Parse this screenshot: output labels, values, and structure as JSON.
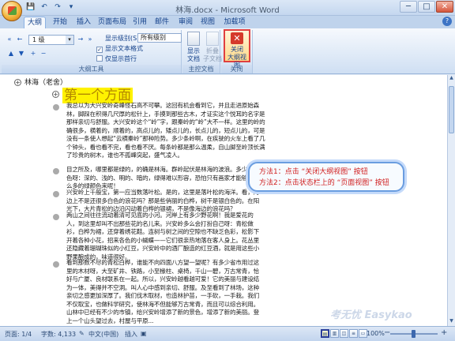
{
  "window": {
    "title": "林海.docx - Microsoft Word",
    "minimize": "─",
    "maximize": "□",
    "close": "✕"
  },
  "qat": {
    "save": "💾",
    "undo": "↶",
    "redo": "↷",
    "more": "▾"
  },
  "tabs": [
    {
      "label": "大纲",
      "active": true
    },
    {
      "label": "开始"
    },
    {
      "label": "插入"
    },
    {
      "label": "页面布局"
    },
    {
      "label": "引用"
    },
    {
      "label": "邮件"
    },
    {
      "label": "审阅"
    },
    {
      "label": "视图"
    },
    {
      "label": "加载项"
    }
  ],
  "help": "?",
  "ribbon": {
    "outline_tools": {
      "label": "大纲工具",
      "level_value": "1 级",
      "show_level_label": "显示级别(S):",
      "show_level_value": "所有级别",
      "show_text_format": "显示文本格式",
      "show_first_line": "仅显示首行",
      "arrows": {
        "promote_top": "«",
        "promote": "←",
        "demote": "→",
        "demote_body": "»",
        "up": "▲",
        "down": "▼",
        "expand": "+",
        "collapse": "−"
      }
    },
    "master_doc": {
      "label": "主控文档",
      "show_doc": "显示\n文档",
      "collapse_subdoc": "折叠\n子文档"
    },
    "close": {
      "label": "关闭",
      "close_outline_line1": "关闭",
      "close_outline_line2": "大纲视图",
      "icon": "✕"
    }
  },
  "document": {
    "top_heading": "林海（老舍）",
    "h1": "第一个方面",
    "paragraphs": [
      "我总以为大兴安岭奇峰怪石高不可攀。这回有机会看到它，并且走进原始森林，脚踩在积得几尺厚的松针上，手摸到那些古木，才证实这个悦耳的名字是那样亲切与舒服。大兴安岭这个“岭”字，跟秦岭的“岭”大不一样。这里的岭的确很多，横着的，顺着的，高点儿的，矮点儿的，长点儿的，短点儿的，可是没有一条使人想起“云横秦岭”那种险势。多少条岭啊，在疾驶的火车上看了几个钟头，看也看不完，看也看不厌。每条岭都是那么温柔，自山脚至岭顶长满了珍贵的树木，谁也不孤峰突起，盛气凌人。",
      "目之所及，哪里都是绿的，的确是林海。群岭起伏是林海的波浪。多少种绿颜色呀：深的、浅的、明的、暗的，绿得难以形容，恐怕只有画家才能够调出这么多的绿颜色来呢！",
      "兴安岭上千般宝，第一应当数落叶松。是的，这里是落叶松的海洋。看，海边上不是还很多白色的浪花吗？那是些俏丽的白桦，树干是银白色的。在阳光下，大片青松的边沿闪动着白桦的银裙，不是像海边的浪花吗？",
      "两山之间往往流动着清可见底的小河。河岸上有多少野花啊！我是爱花的人，到这里却叫不出那些花的名儿来。兴安岭多么会打扮自己呀：青松做衫，白桦为裙，还穿着绣花鞋。连树与树之间的空隙也不缺乏色彩，松影下开着各种小花，招来各色的小蝴蝶——它们很亲热地落在客人身上。花丛里还隐藏着珊瑚珠似的小红豆，兴安岭中的酒厂酿造的红豆酒，就是用这些小野果酿成的，味道很好。",
      "看到那数不尽的青松白桦，谁能不向四面八方望一望呢？有多少省市用过这里的木材呀，大至矿井、铁路，小至椽柱、桌椅，千山一碧，万古常青，恰好与广厦、良材联系在一起。所以，兴安岭越看越可爱！它的美丽与建设结为一体，美得并不空洞。叫人心中感到亲切、舒服。及至看到了林场，这种亲切之感更加深厚了。我们伐木取材，也造林护苗，一手砍，一手栽。我们不仅取宝，也做科学研究，使林海不但能够万古常青，而且可以综合利用。山林中已经有不少的市镇，给兴安岭增添了新的景色，增添了新的美丽。登上一个山头望过去，村屋与平原..."
    ]
  },
  "callout": {
    "line1": "方法1：点击 “关闭大纲视图” 按钮",
    "line2": "方法2：点击状态栏上的 “页面视图” 按钮"
  },
  "statusbar": {
    "page": "页面: 1/4",
    "words": "字数: 4,133",
    "language": "中文(中国)",
    "insert_mode": "插入",
    "zoom": "100%",
    "zoom_minus": "−",
    "zoom_plus": "+"
  },
  "watermark": "考无忧 Easykao",
  "colors": {
    "accent": "#15428b",
    "highlight": "#fff200",
    "callout_text": "#d01f1f",
    "close_outline_border": "#e04040"
  }
}
